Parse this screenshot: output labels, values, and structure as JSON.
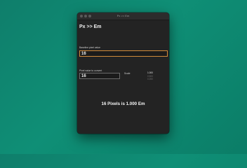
{
  "window": {
    "title": "Px >> Em"
  },
  "app": {
    "title": "Px >> Em"
  },
  "base": {
    "label": "Baseline pixel value",
    "value": "16"
  },
  "convert": {
    "label": "Pixel value to convert",
    "value": "16"
  },
  "scale": {
    "label": "Scale",
    "options": [
      "1.000",
      "0.500",
      "0.250"
    ],
    "selected": "1.000"
  },
  "result": {
    "text": "16 Pixels is 1.000 Em"
  },
  "colors": {
    "accent_focus": "#d08a3a",
    "window_bg": "#232323",
    "desktop": "#0f8f76"
  }
}
